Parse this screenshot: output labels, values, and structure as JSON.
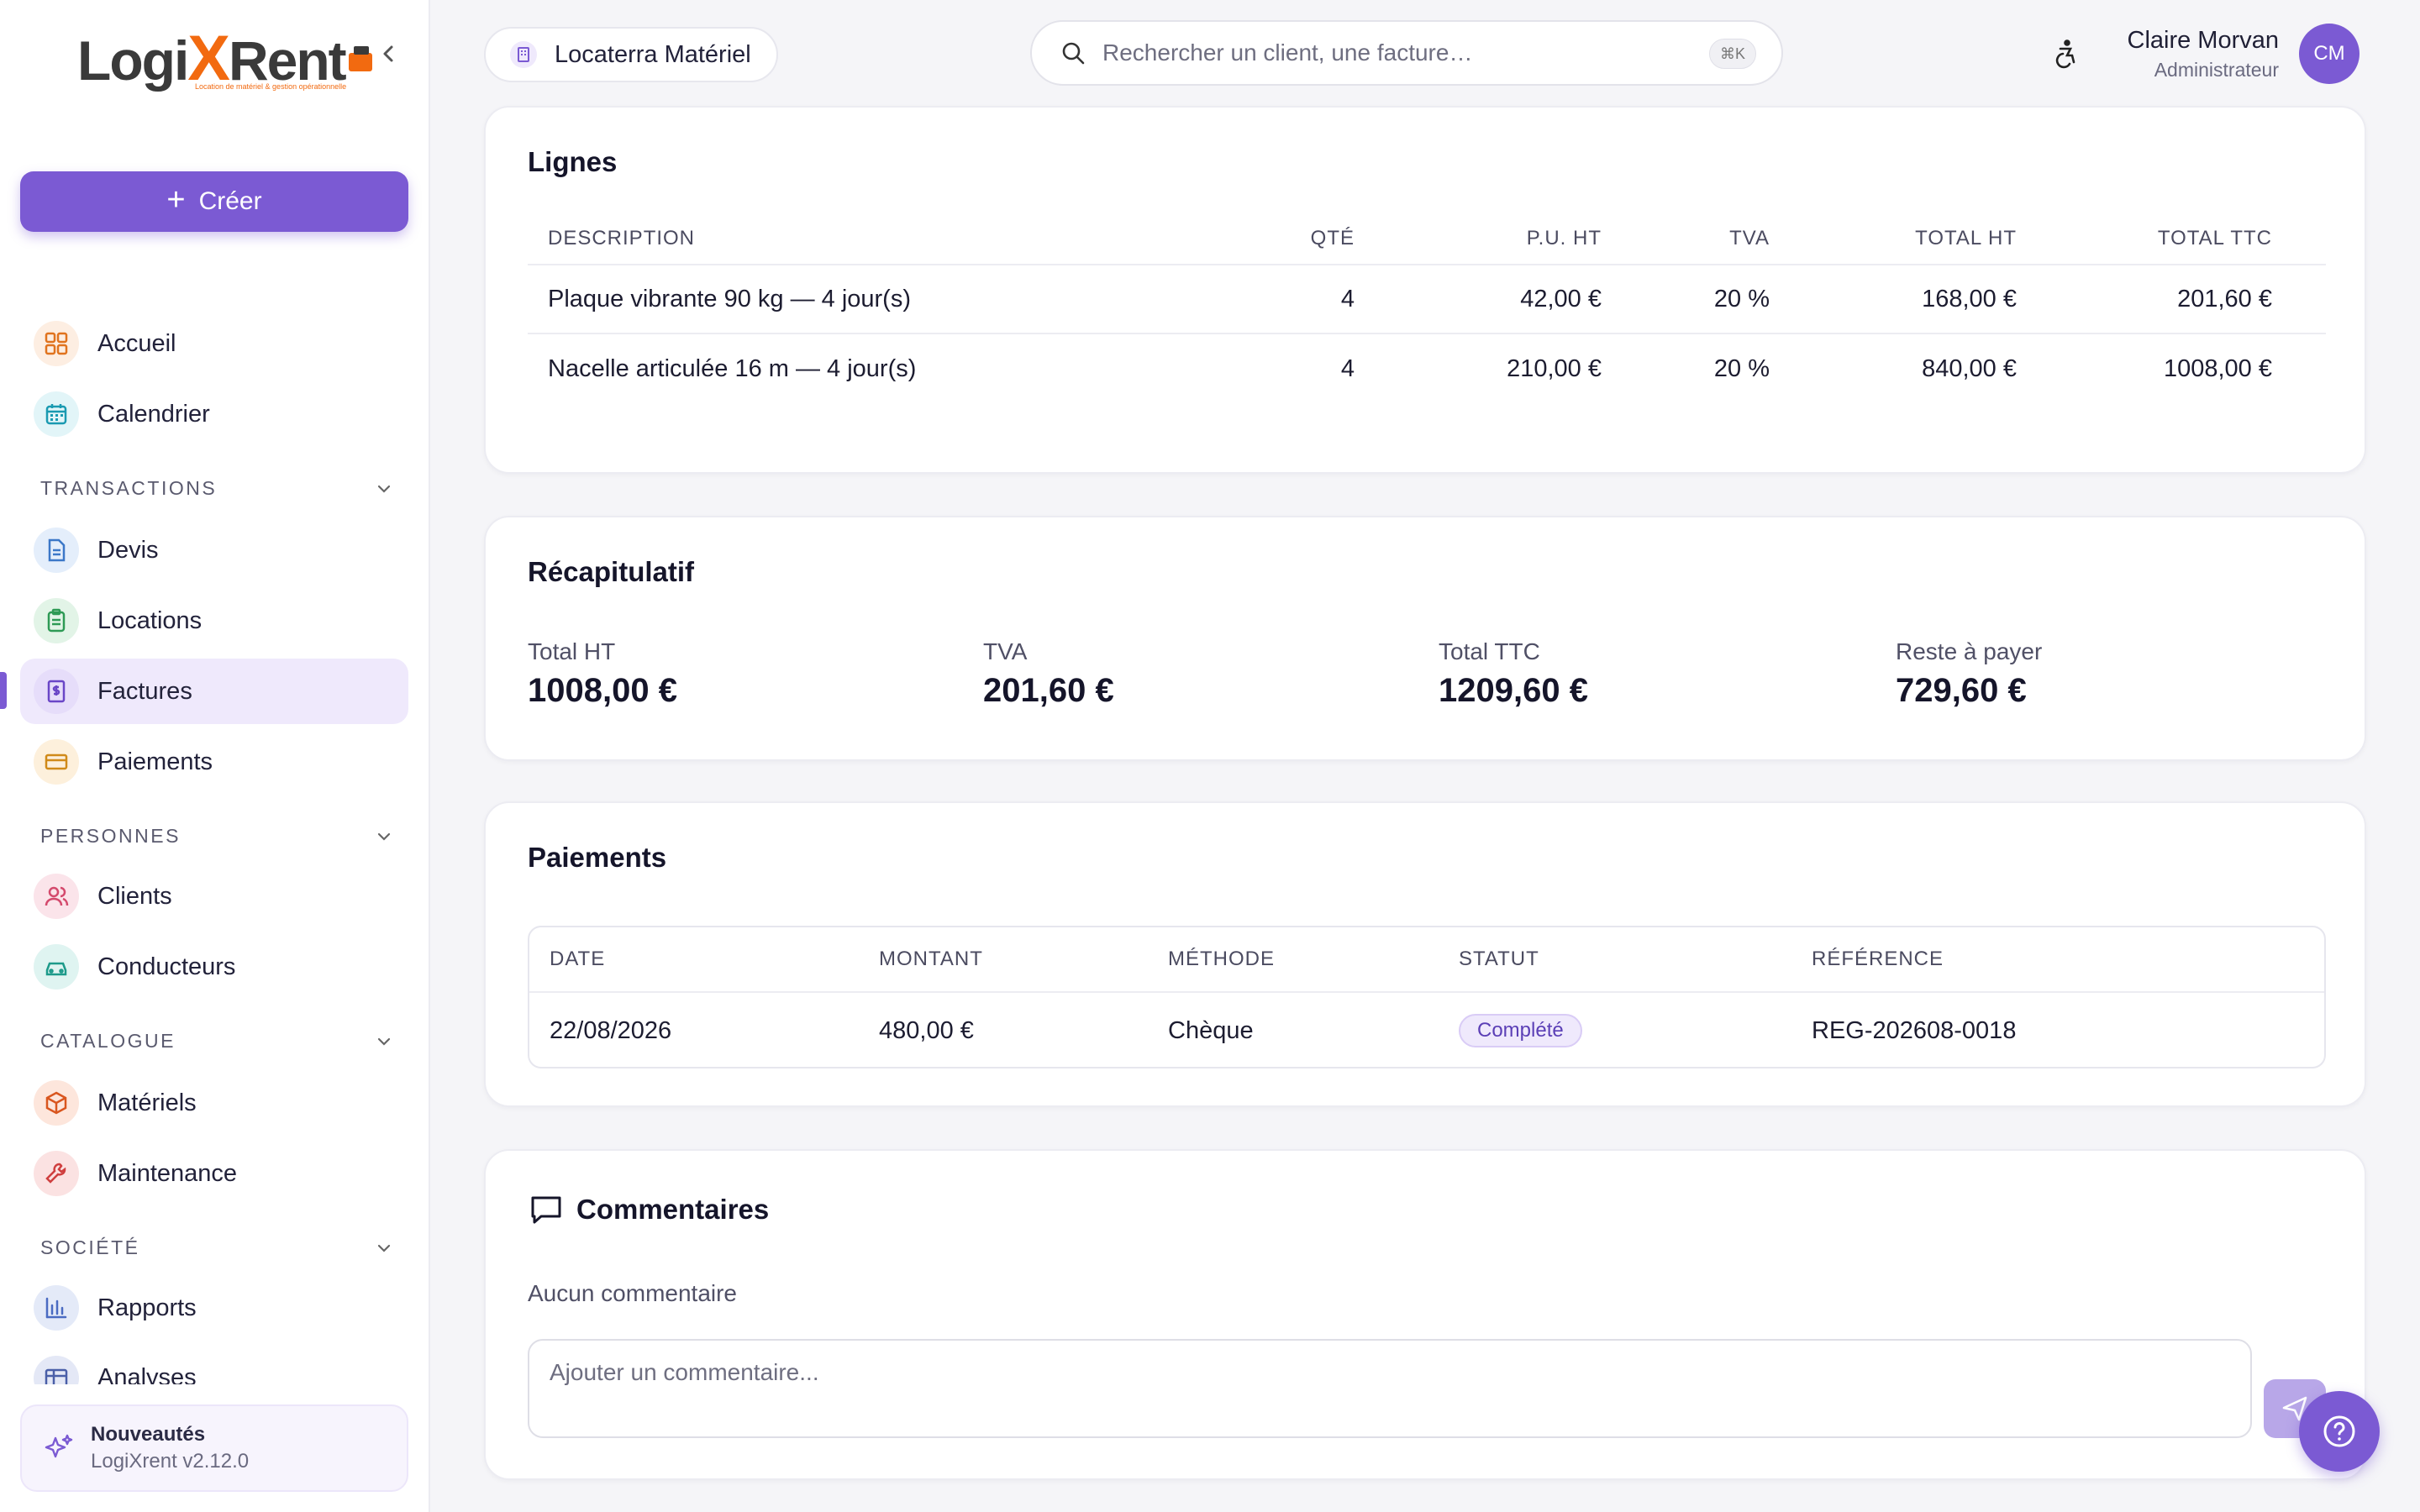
{
  "brand": {
    "logo_text_left": "Logi",
    "logo_text_x": "X",
    "logo_text_right": "Rent",
    "logo_tagline": "Location de matériel & gestion opérationnelle",
    "accent": "#7b5ad3",
    "logo_orange": "#f26a10"
  },
  "sidebar": {
    "create_label": "Créer",
    "items_top": [
      {
        "label": "Accueil",
        "icon": "grid-icon"
      },
      {
        "label": "Calendrier",
        "icon": "calendar-icon"
      }
    ],
    "sections": [
      {
        "title": "TRANSACTIONS",
        "items": [
          {
            "label": "Devis",
            "icon": "document-icon"
          },
          {
            "label": "Locations",
            "icon": "clipboard-icon"
          },
          {
            "label": "Factures",
            "icon": "invoice-icon",
            "active": true
          },
          {
            "label": "Paiements",
            "icon": "card-icon"
          }
        ]
      },
      {
        "title": "PERSONNES",
        "items": [
          {
            "label": "Clients",
            "icon": "users-icon"
          },
          {
            "label": "Conducteurs",
            "icon": "car-icon"
          }
        ]
      },
      {
        "title": "CATALOGUE",
        "items": [
          {
            "label": "Matériels",
            "icon": "box-icon"
          },
          {
            "label": "Maintenance",
            "icon": "wrench-icon"
          }
        ]
      },
      {
        "title": "SOCIÉTÉ",
        "items": [
          {
            "label": "Rapports",
            "icon": "bar-chart-icon"
          },
          {
            "label": "Analyses",
            "icon": "table-icon"
          }
        ]
      }
    ],
    "news": {
      "title": "Nouveautés",
      "version": "LogiXrent v2.12.0"
    }
  },
  "topbar": {
    "company": "Locaterra Matériel",
    "search_placeholder": "Rechercher un client, une facture…",
    "search_shortcut": "⌘K",
    "user_name": "Claire Morvan",
    "user_role": "Administrateur",
    "user_initials": "CM"
  },
  "lines": {
    "title": "Lignes",
    "headers": [
      "DESCRIPTION",
      "QTÉ",
      "P.U. HT",
      "TVA",
      "TOTAL HT",
      "TOTAL TTC"
    ],
    "rows": [
      {
        "description": "Plaque vibrante 90 kg — 4 jour(s)",
        "qte": "4",
        "pu_ht": "42,00 €",
        "tva": "20 %",
        "total_ht": "168,00 €",
        "total_ttc": "201,60 €"
      },
      {
        "description": "Nacelle articulée 16 m — 4 jour(s)",
        "qte": "4",
        "pu_ht": "210,00 €",
        "tva": "20 %",
        "total_ht": "840,00 €",
        "total_ttc": "1008,00 €"
      }
    ]
  },
  "summary": {
    "title": "Récapitulatif",
    "items": [
      {
        "label": "Total HT",
        "value": "1008,00 €"
      },
      {
        "label": "TVA",
        "value": "201,60 €"
      },
      {
        "label": "Total TTC",
        "value": "1209,60 €"
      },
      {
        "label": "Reste à payer",
        "value": "729,60 €"
      }
    ]
  },
  "payments": {
    "title": "Paiements",
    "headers": [
      "DATE",
      "MONTANT",
      "MÉTHODE",
      "STATUT",
      "RÉFÉRENCE"
    ],
    "rows": [
      {
        "date": "22/08/2026",
        "montant": "480,00 €",
        "methode": "Chèque",
        "statut": "Complété",
        "reference": "REG-202608-0018"
      }
    ]
  },
  "comments": {
    "title": "Commentaires",
    "empty": "Aucun commentaire",
    "placeholder": "Ajouter un commentaire..."
  }
}
